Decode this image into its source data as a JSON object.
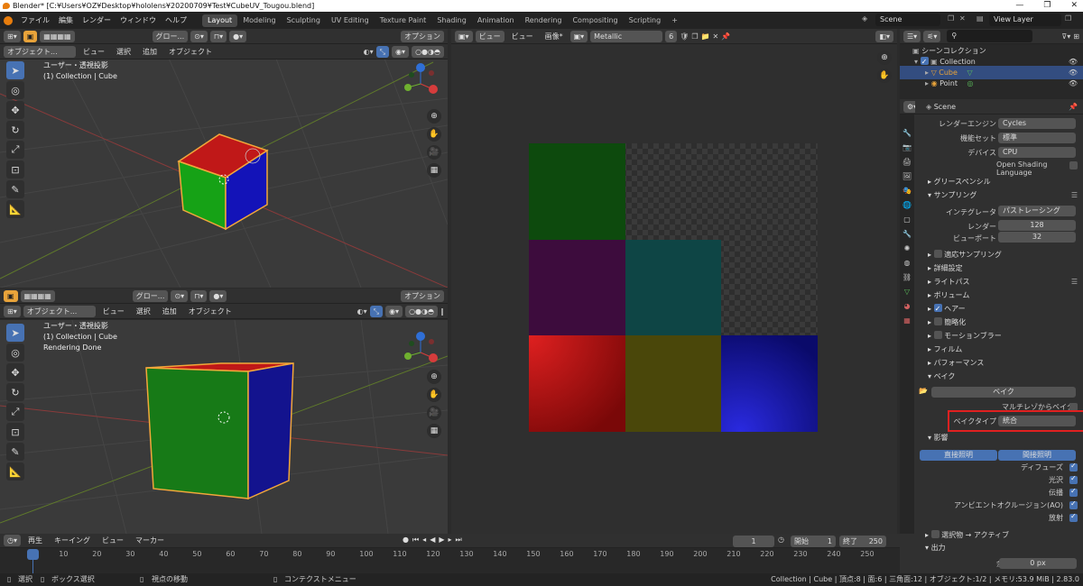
{
  "window": {
    "title": "Blender* [C:¥Users¥OZ¥Desktop¥hololens¥20200709¥Test¥CubeUV_Tougou.blend]",
    "min": "—",
    "max": "❐",
    "close": "✕"
  },
  "topbar": {
    "menus": [
      "ファイル",
      "編集",
      "レンダー",
      "ウィンドウ",
      "ヘルプ"
    ],
    "workspaces": [
      "Layout",
      "Modeling",
      "Sculpting",
      "UV Editing",
      "Texture Paint",
      "Shading",
      "Animation",
      "Rendering",
      "Compositing",
      "Scripting"
    ],
    "add_tab": "+",
    "scene": "Scene",
    "view_layer": "View Layer"
  },
  "viewport_top": {
    "mode": "オブジェクト...",
    "menus": [
      "ビュー",
      "選択",
      "追加",
      "オブジェクト"
    ],
    "transform": "グロー...",
    "options": "オプション",
    "view_name": "ユーザー・透視投影",
    "collection": "(1) Collection | Cube"
  },
  "viewport_bottom": {
    "mode": "オブジェクト...",
    "menus": [
      "ビュー",
      "選択",
      "追加",
      "オブジェクト"
    ],
    "transform": "グロー...",
    "options": "オプション",
    "view_name": "ユーザー・透視投影",
    "collection": "(1) Collection | Cube",
    "status": "Rendering Done"
  },
  "image_editor": {
    "menus": [
      "ビュー",
      "ビュー",
      "画像*"
    ],
    "image": "Metallic",
    "users": "6",
    "colors": {
      "cells": [
        "#0c4a0c",
        null,
        null,
        "#3b0d3b",
        "#0e4646",
        null,
        "#a01010",
        "#4a4a0a",
        "#0a0a8a"
      ]
    }
  },
  "outliner": {
    "root": "シーンコレクション",
    "items": [
      {
        "name": "Collection",
        "level": 1
      },
      {
        "name": "Cube",
        "level": 2,
        "selected": true
      },
      {
        "name": "Point",
        "level": 2
      }
    ]
  },
  "properties": {
    "scene": "Scene",
    "render_engine_label": "レンダーエンジン",
    "render_engine": "Cycles",
    "feature_set_label": "機能セット",
    "feature_set": "標準",
    "device_label": "デバイス",
    "device": "CPU",
    "osl": "Open Shading Language",
    "grease_pencil": "グリースペンシル",
    "sampling": "サンプリング",
    "integrator_label": "インテグレータ",
    "integrator": "パストレーシング",
    "render_label": "レンダー",
    "render_samples": "128",
    "viewport_label": "ビューポート",
    "viewport_samples": "32",
    "adaptive": "適応サンプリング",
    "advanced": "詳細設定",
    "light_paths": "ライトパス",
    "volumes": "ボリューム",
    "hair": "ヘアー",
    "simplify": "簡略化",
    "motion_blur": "モーションブラー",
    "film": "フィルム",
    "performance": "パフォーマンス",
    "bake_section": "ベイク",
    "bake_button": "ベイク",
    "multires": "マルチレゾからベイク",
    "bake_type_label": "ベイクタイプ",
    "bake_type": "統合",
    "influence": "影響",
    "direct": "直接照明",
    "indirect": "間接照明",
    "diffuse": "ディフューズ",
    "glossy": "光沢",
    "transmission": "伝播",
    "ao": "アンビエントオクルージョン(AO)",
    "emit": "放射",
    "selected_to_active": "選択物 → アクティブ",
    "output": "出力",
    "margin_label": "余白",
    "margin": "0 px"
  },
  "timeline": {
    "menus": [
      "再生",
      "キーイング",
      "ビュー",
      "マーカー"
    ],
    "current": "1",
    "start_label": "開始",
    "start": "1",
    "end_label": "終了",
    "end": "250",
    "ticks": [
      "1",
      "10",
      "20",
      "30",
      "40",
      "50",
      "60",
      "70",
      "80",
      "90",
      "100",
      "110",
      "120",
      "130",
      "140",
      "150",
      "160",
      "170",
      "180",
      "190",
      "200",
      "210",
      "220",
      "230",
      "240",
      "250"
    ]
  },
  "statusbar": {
    "select": "選択",
    "box_select": "ボックス選択",
    "rotate_view": "視点の移動",
    "context_menu": "コンテクストメニュー",
    "info": "Collection | Cube | 頂点:8 | 面:6 | 三角面:12 | オブジェクト:1/2 | メモリ:53.9 MiB | 2.83.0"
  }
}
